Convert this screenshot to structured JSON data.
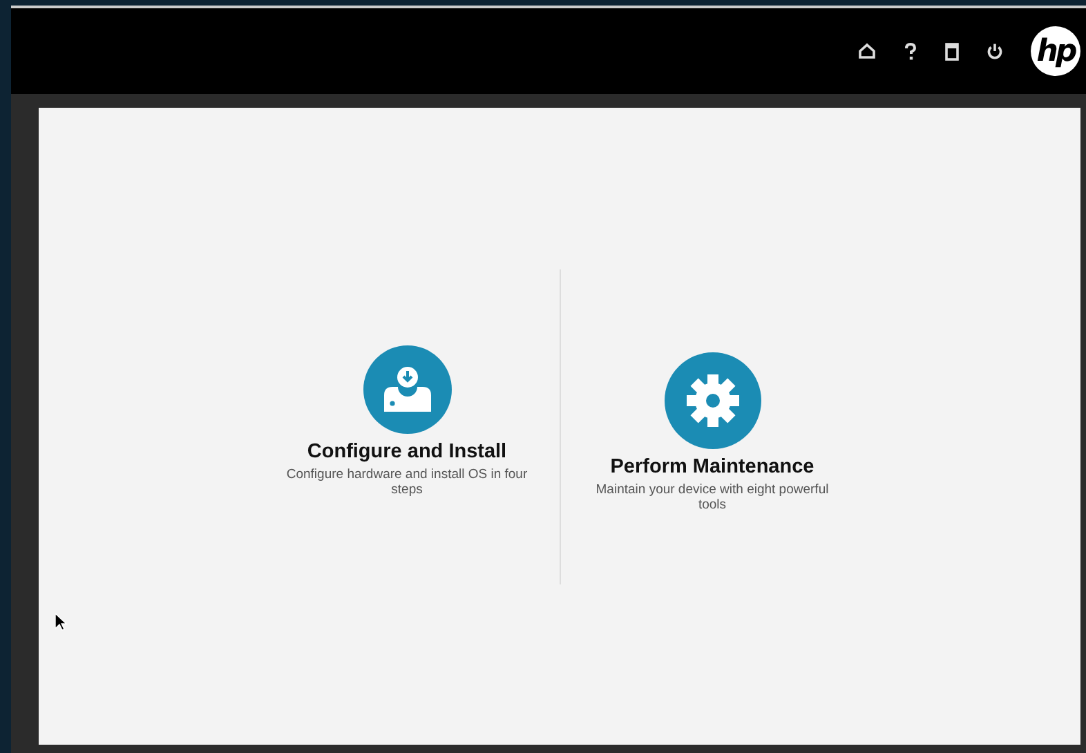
{
  "toolbar": {
    "logo": "hp",
    "icons": [
      {
        "kind": "home"
      },
      {
        "kind": "help"
      },
      {
        "kind": "document"
      },
      {
        "kind": "power"
      }
    ]
  },
  "options": [
    {
      "kind": "install",
      "title": "Configure and Install",
      "description": "Configure hardware and install OS in four steps"
    },
    {
      "kind": "maintenance",
      "title": "Perform Maintenance",
      "description": "Maintain your device with eight powerful tools"
    }
  ]
}
